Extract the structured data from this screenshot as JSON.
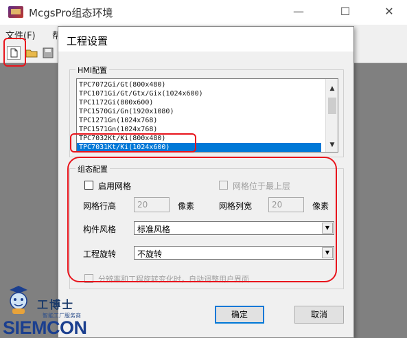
{
  "app": {
    "title": "McgsPro组态环境",
    "window_controls": {
      "minimize": "—",
      "maximize": "☐",
      "close": "✕"
    },
    "menu": {
      "file": "文件(F)",
      "partial": "帮"
    }
  },
  "dialog": {
    "title": "工程设置",
    "hmi_group": {
      "label": "HMI配置",
      "models": [
        "TPC7072Gi/Gt(800x480)",
        "TPC1071Gi/Gt/Gtx/Gix(1024x600)",
        "TPC1172Gi(800x600)",
        "TPC1570Gi/Gn(1920x1080)",
        "TPC1271Gn(1024x768)",
        "TPC1571Gn(1024x768)",
        "TPC7032Kt/Ki(800x480)",
        "TPC7031Kt/Ki(1024x600)"
      ],
      "selected_index": 7
    },
    "config_group": {
      "label": "组态配置",
      "enable_grid_label": "启用网格",
      "grid_on_top_label": "网格位于最上层",
      "row_height_label": "网格行高",
      "row_height_value": "20",
      "row_height_unit": "像素",
      "col_width_label": "网格列宽",
      "col_width_value": "20",
      "col_width_unit": "像素",
      "style_label": "构件风格",
      "style_value": "标准风格",
      "rotation_label": "工程旋转",
      "rotation_value": "不旋转",
      "auto_adjust_label": "分辨率和工程旋转变化时，自动调整用户界面"
    },
    "ok_label": "确定",
    "cancel_label": "取消"
  },
  "watermark": {
    "cn_name": "工博士",
    "tagline": "智能工厂服务商",
    "brand": "SIEMCON"
  },
  "colors": {
    "selection": "#0078d7",
    "annotation": "#e8141c",
    "brand": "#1b3f8f"
  }
}
